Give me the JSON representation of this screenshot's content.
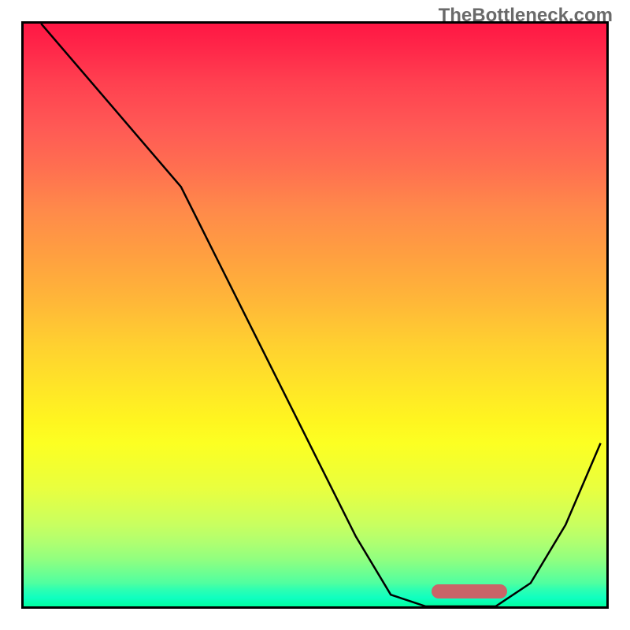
{
  "watermark": "TheBottleneck.com",
  "chart_data": {
    "type": "line",
    "title": "",
    "xlabel": "",
    "ylabel": "",
    "xlim": [
      0,
      100
    ],
    "ylim": [
      0,
      100
    ],
    "x": [
      3,
      9,
      15,
      21,
      27,
      33,
      39,
      45,
      51,
      57,
      63,
      69,
      75,
      81,
      87,
      93,
      99
    ],
    "values": [
      100,
      93,
      86,
      79,
      72,
      60,
      48,
      36,
      24,
      12,
      2,
      0,
      0,
      0,
      4,
      14,
      28
    ],
    "gradient_stops": [
      {
        "pos": 0,
        "color": "#ff1744"
      },
      {
        "pos": 18,
        "color": "#ff5a55"
      },
      {
        "pos": 40,
        "color": "#ffa040"
      },
      {
        "pos": 62,
        "color": "#ffe428"
      },
      {
        "pos": 76,
        "color": "#f2ff30"
      },
      {
        "pos": 92,
        "color": "#90ff80"
      },
      {
        "pos": 100,
        "color": "#00ffa0"
      }
    ],
    "optimal_range": {
      "start": 70,
      "end": 83
    },
    "grid": false,
    "legend": false
  }
}
